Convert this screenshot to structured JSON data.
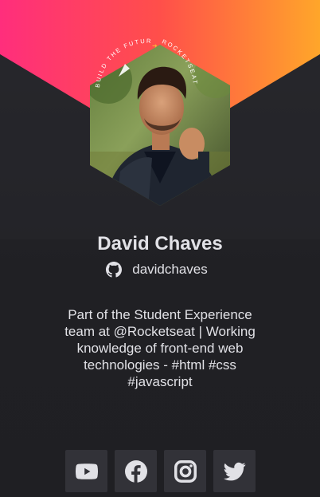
{
  "profile": {
    "name": "David Chaves",
    "github_username": "davidchaves",
    "bio": "Part of the Student Experience team at @Rocketseat | Working knowledge of front-end web technologies - #html #css #javascript",
    "badge_text_left": "BUILD THE FUTURE",
    "badge_text_right": "ROCKETSEAT"
  },
  "socials": [
    {
      "name": "youtube",
      "icon": "youtube-icon"
    },
    {
      "name": "facebook",
      "icon": "facebook-icon"
    },
    {
      "name": "instagram",
      "icon": "instagram-icon"
    },
    {
      "name": "twitter",
      "icon": "twitter-icon"
    }
  ],
  "colors": {
    "background": "#202024",
    "gradient_start": "#ff2d7a",
    "gradient_mid": "#ff5a3c",
    "gradient_end": "#ffa32a",
    "text": "#e1e1e6",
    "button": "#323238"
  }
}
